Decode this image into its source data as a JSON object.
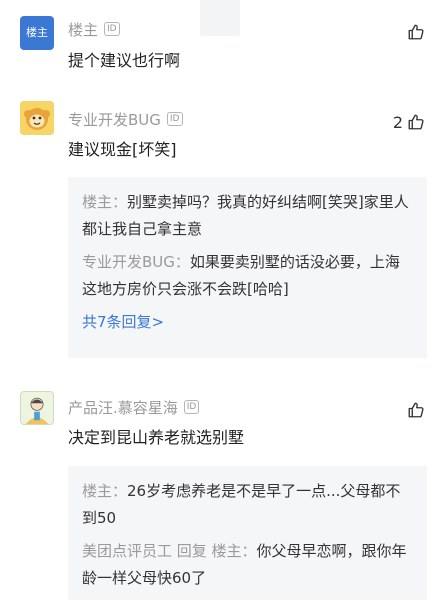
{
  "comments": [
    {
      "author": "楼主",
      "avatar_text": "楼主",
      "id_badge": "ID",
      "text": "提个建议也行啊",
      "likes": ""
    },
    {
      "author": "专业开发BUG",
      "id_badge": "ID",
      "text": "建议现金[坏笑]",
      "likes": "2",
      "replies": [
        {
          "author": "楼主：",
          "text": "别墅卖掉吗？我真的好纠结啊[笑哭]家里人都让我自己拿主意"
        },
        {
          "author": "专业开发BUG：",
          "text": "如果要卖别墅的话没必要，上海这地方房价只会涨不会跌[哈哈]"
        }
      ],
      "more_replies": "共7条回复>"
    },
    {
      "author": "产品汪.慕容星海",
      "id_badge": "ID",
      "text": "决定到昆山养老就选别墅",
      "likes": "",
      "replies": [
        {
          "author": "楼主：",
          "text": "26岁考虑养老是不是早了一点...父母都不到50"
        },
        {
          "author": "美团点评员工 回复 楼主：",
          "text": "你父母早恋啊，跟你年龄一样父母快60了"
        }
      ]
    }
  ],
  "icons": {
    "like": "thumbs-up-icon",
    "id_badge": "id-icon"
  },
  "colors": {
    "owner_avatar": "#3a78d4",
    "link": "#3a78d4",
    "muted": "#9a9a9a",
    "reply_bg": "#f5f6f8"
  }
}
